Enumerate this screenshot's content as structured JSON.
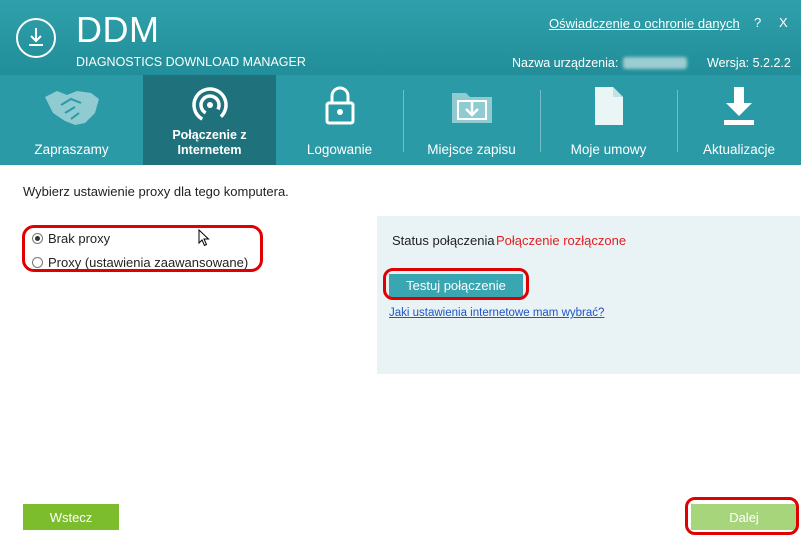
{
  "header": {
    "app_name": "DDM",
    "app_full_name": "DIAGNOSTICS DOWNLOAD MANAGER",
    "privacy_link": "Oświadczenie o ochronie danych",
    "help": "?",
    "close": "X",
    "device_label": "Nazwa urządzenia:",
    "version_label": "Wersja: 5.2.2.2",
    "logo_icon": "download-circle-icon"
  },
  "nav": {
    "items": [
      {
        "label": "Zapraszamy",
        "icon": "handshake-icon"
      },
      {
        "label": "Połączenie z Internetem",
        "icon": "wireless-signal-icon",
        "active": true
      },
      {
        "label": "Logowanie",
        "icon": "lock-icon"
      },
      {
        "label": "Miejsce zapisu",
        "icon": "folder-download-icon"
      },
      {
        "label": "Moje umowy",
        "icon": "document-icon"
      },
      {
        "label": "Aktualizacje",
        "icon": "download-arrow-icon"
      }
    ]
  },
  "content": {
    "instruction": "Wybierz ustawienie proxy dla tego komputera.",
    "proxy_options": [
      {
        "label": "Brak proxy",
        "selected": true
      },
      {
        "label": "Proxy (ustawienia zaawansowane)",
        "selected": false
      }
    ],
    "status_label": "Status połączenia",
    "status_value": "Połączenie rozłączone",
    "test_button": "Testuj połączenie",
    "settings_link": "Jaki ustawienia internetowe mam wybrać?"
  },
  "footer": {
    "back_button": "Wstecz",
    "next_button": "Dalej"
  },
  "colors": {
    "header_teal": "#218e99",
    "active_tab": "#1f727c",
    "status_error": "#e02020",
    "back_green": "#7cbd2e",
    "next_green_disabled": "#a7d57b",
    "annotation_red": "#e00000"
  }
}
